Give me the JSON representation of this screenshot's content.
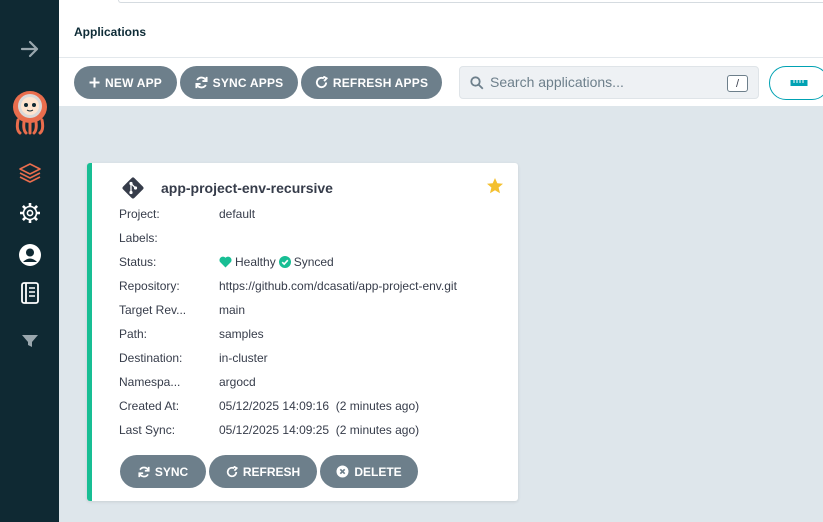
{
  "header": {
    "title": "Applications"
  },
  "toolbar": {
    "new_app": "NEW APP",
    "sync_apps": "SYNC APPS",
    "refresh_apps": "REFRESH APPS",
    "search_placeholder": "Search applications...",
    "search_shortcut": "/"
  },
  "sidebar": {
    "items": [
      {
        "icon": "arrow-right-icon"
      },
      {
        "icon": "argo-logo-icon"
      },
      {
        "icon": "layers-icon",
        "active": true
      },
      {
        "icon": "gear-icon"
      },
      {
        "icon": "user-icon"
      },
      {
        "icon": "book-icon"
      },
      {
        "icon": "filter-icon"
      }
    ]
  },
  "app": {
    "name": "app-project-env-recursive",
    "favorite": true,
    "fields": {
      "project": {
        "label": "Project:",
        "value": "default"
      },
      "labels": {
        "label": "Labels:",
        "value": ""
      },
      "status": {
        "label": "Status:",
        "health": "Healthy",
        "sync": "Synced"
      },
      "repository": {
        "label": "Repository:",
        "value": "https://github.com/dcasati/app-project-env.git"
      },
      "target_revision": {
        "label": "Target Rev...",
        "value": "main"
      },
      "path": {
        "label": "Path:",
        "value": "samples"
      },
      "destination": {
        "label": "Destination:",
        "value": "in-cluster"
      },
      "namespace": {
        "label": "Namespa...",
        "value": "argocd"
      },
      "created_at": {
        "label": "Created At:",
        "value": "05/12/2025 14:09:16  (2 minutes ago)"
      },
      "last_sync": {
        "label": "Last Sync:",
        "value": "05/12/2025 14:09:25  (2 minutes ago)"
      }
    },
    "actions": {
      "sync": "SYNC",
      "refresh": "REFRESH",
      "delete": "DELETE"
    }
  },
  "colors": {
    "sidebar_bg": "#0f2933",
    "accent": "#00a2b3",
    "healthy": "#18be94",
    "button": "#6d7f8b",
    "active_icon": "#e96d4d",
    "star": "#f4c030"
  }
}
